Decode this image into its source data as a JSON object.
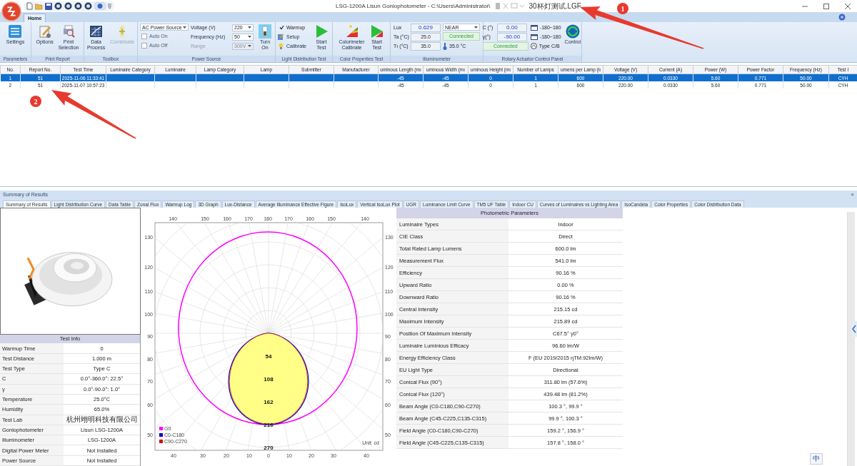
{
  "window": {
    "title": "LSG-1200A Lisun Goniophotometer  - C:\\Users\\Administrator\\",
    "title_tail": "30杯灯测试.LGF"
  },
  "ribbon_tabs": [
    {
      "label": "Home",
      "selected": true
    }
  ],
  "ribbon": {
    "groups": [
      {
        "caption": "Parameters",
        "buttons": [
          {
            "label": "Settings",
            "disabled": false
          }
        ]
      },
      {
        "caption": "Print Report",
        "buttons": [
          {
            "label": "Options",
            "disabled": false
          },
          {
            "label": "Print Selection",
            "disabled": false
          }
        ]
      },
      {
        "caption": "Toolbox",
        "buttons": [
          {
            "label": "Data Process",
            "disabled": false
          },
          {
            "label": "Combinate",
            "disabled": true
          }
        ]
      },
      {
        "caption": "Power Source",
        "source": "AC Power Source",
        "checks": [
          {
            "label": "Auto On",
            "checked": false
          },
          {
            "label": "Auto Off",
            "checked": false
          }
        ],
        "fields": [
          {
            "label": "Voltage (V)",
            "value": "220",
            "disabled": false
          },
          {
            "label": "Frequency (Hz)",
            "value": "50",
            "disabled": false
          },
          {
            "label": "Range",
            "value": "300V",
            "disabled": true
          }
        ],
        "buttons": [
          {
            "label": "Turn On",
            "disabled": false
          }
        ]
      },
      {
        "caption": "Light Distribution Test",
        "checks": [
          {
            "label": "Warmup",
            "checked": true
          }
        ],
        "links": [
          "Setup",
          "Calibrate"
        ],
        "buttons": [
          {
            "label": "Start Test",
            "disabled": false
          }
        ]
      },
      {
        "caption": "Color Properties Test",
        "buttons": [
          {
            "label": "Colorimeter Calibrate",
            "disabled": false
          },
          {
            "label": "Start Test",
            "disabled": false
          }
        ]
      },
      {
        "caption": "Illuminometer",
        "readings": [
          {
            "label": "Lux",
            "value": "0.629"
          },
          {
            "label": "Ta (°C)",
            "value": "25.0"
          },
          {
            "label": "Tı (°C)",
            "value": "35.0"
          }
        ],
        "mode": "NEAR",
        "status": "Connected",
        "temperature": "35.0 °C"
      },
      {
        "caption": "Rotary Actuator Control Panel",
        "readings": [
          {
            "label": "C (°)",
            "value": "0.00"
          },
          {
            "label": "γ(°)",
            "value": "-90.00"
          }
        ],
        "status": "Connected",
        "ranges": [
          "-180~180",
          "-180~180"
        ],
        "type": "Type C/B",
        "buttons": [
          {
            "label": "Control",
            "disabled": false
          }
        ]
      }
    ]
  },
  "table": {
    "columns": [
      "No.",
      "Report No.",
      "Test Time",
      "Luminaire Category",
      "Luminaire",
      "Lamp Category",
      "Lamp",
      "Submitter",
      "Manufacturer",
      "uminous Length (mı",
      "uminous Width (mı",
      "uminous Height (mı",
      "Number of Lamps",
      "umens per Lamp (lı",
      "Voltage (V)",
      "Current (A)",
      "Power (W)",
      "Power Factor",
      "Frequency (Hz)",
      "Test I"
    ],
    "rows": [
      {
        "selected": true,
        "cells": [
          "1",
          "51",
          "2025-11-06 11:33:41",
          null,
          null,
          null,
          null,
          null,
          null,
          "-45",
          "-45",
          "0",
          "1",
          "600",
          "220.00",
          "0.0330",
          "5.60",
          "0.771",
          "50.00",
          "CYH"
        ]
      },
      {
        "selected": false,
        "cells": [
          "2",
          "51",
          "2025-11-07 10:57:23",
          null,
          null,
          null,
          null,
          null,
          null,
          "-45",
          "-45",
          "0",
          "1",
          "600",
          "220.00",
          "0.0330",
          "5.60",
          "0.771",
          "50.00",
          "CYH"
        ]
      }
    ]
  },
  "results": {
    "title": "Summary of Results",
    "close": "×",
    "tabs": [
      {
        "label": "Summary of Results",
        "selected": true
      },
      {
        "label": "Light Distribution Curve",
        "selected": false
      },
      {
        "label": "Data Table",
        "selected": false
      },
      {
        "label": "Zonal Flux",
        "selected": false
      },
      {
        "label": "Warmup Log",
        "selected": false
      },
      {
        "label": "3D Graph",
        "selected": false
      },
      {
        "label": "Lux-Distance",
        "selected": false
      },
      {
        "label": "Average Illuminance Effective Figure",
        "selected": false
      },
      {
        "label": "IsoLux",
        "selected": false
      },
      {
        "label": "Vertical IsoLux Plot",
        "selected": false
      },
      {
        "label": "UGR",
        "selected": false
      },
      {
        "label": "Luminance Limit Curve",
        "selected": false
      },
      {
        "label": "TM5 UF Table",
        "selected": false
      },
      {
        "label": "Indoor CU",
        "selected": false
      },
      {
        "label": "Curves of Luminaires vs Lighting Area",
        "selected": false
      },
      {
        "label": "IsoCandela",
        "selected": false
      },
      {
        "label": "Color Properties",
        "selected": false
      },
      {
        "label": "Color Distribution Data",
        "selected": false
      }
    ],
    "test_info": {
      "title": "Test Info",
      "rows": [
        {
          "label": "Warmup Time",
          "value": "0"
        },
        {
          "label": "Test Distance",
          "value": "1.000 m"
        },
        {
          "label": "Test Type",
          "value": "Type C"
        },
        {
          "label": "C",
          "value": "0.0°-360.0°: 22.5°"
        },
        {
          "label": "γ",
          "value": "0.0°-90.0°: 1.0°"
        },
        {
          "label": "Temperature",
          "value": "25.0°C"
        },
        {
          "label": "Humidity",
          "value": "65.0%"
        },
        {
          "label": "Test Lab",
          "value": "杭州翊明科技有限公司"
        },
        {
          "label": "Goniophotometer",
          "value": "Lisun LSG-1200A"
        },
        {
          "label": "Illuminometer",
          "value": "LSG-1200A"
        },
        {
          "label": "Digital Power Meter",
          "value": "Not Installed"
        },
        {
          "label": "Power Source",
          "value": "Not Installed"
        }
      ]
    },
    "chart": {
      "top_ticks": [
        "140",
        "150",
        "160",
        "170",
        "180",
        "170",
        "160",
        "150",
        "140"
      ],
      "bottom_ticks": [
        "40",
        "30",
        "20",
        "10",
        "0",
        "10",
        "20",
        "30",
        "40"
      ],
      "left_ticks": [
        "130",
        "120",
        "110",
        "100",
        "90",
        "80",
        "70",
        "60",
        "50"
      ],
      "right_ticks": [
        "130",
        "120",
        "110",
        "100",
        "90",
        "80",
        "70",
        "60",
        "50"
      ],
      "radial_labels": [
        "54",
        "108",
        "162",
        "216",
        "270"
      ],
      "legend": [
        {
          "label": "G0",
          "color": "#ff00ff"
        },
        {
          "label": "C0-C180",
          "color": "#0000cc"
        },
        {
          "label": "C90-C270",
          "color": "#dd0000"
        }
      ],
      "unit": "Unit: cd"
    },
    "parameters": {
      "title": "Photometric Parameters",
      "rows": [
        {
          "label": "Luminaire Types",
          "value": "Indoor"
        },
        {
          "label": "CIE Class",
          "value": "Direct"
        },
        {
          "label": "Total Rated Lamp Lumens",
          "value": "600.0 lm"
        },
        {
          "label": "Measurement Flux",
          "value": "541.0 lm"
        },
        {
          "label": "Efficiency",
          "value": "90.16 %"
        },
        {
          "label": "Upward Ratio",
          "value": "0.00 %"
        },
        {
          "label": "Downward Ratio",
          "value": "90.16 %"
        },
        {
          "label": "Central Intensity",
          "value": "215.15 cd"
        },
        {
          "label": "Maximum Intensity",
          "value": "215.89 cd"
        },
        {
          "label": "Position Of Maximum Intensity",
          "value": "C67.5° γ0°"
        },
        {
          "label": "Luminaire Luminious Efficacy",
          "value": "96.60 lm/W"
        },
        {
          "label": "Energy Efficiency Class",
          "value": "F (EU 2019/2015 ηTM:92lm/W)"
        },
        {
          "label": "EU Light Type",
          "value": "Directional"
        },
        {
          "label": "Conical Flux (90°)",
          "value": "311.80 lm (57.6%)"
        },
        {
          "label": "Conical Flux (120°)",
          "value": "439.48 lm (81.2%)"
        },
        {
          "label": "Beam Angle (C0-C180,C90-C270)",
          "value": "100.3 °, 99.9 °"
        },
        {
          "label": "Beam Angle (C45-C225,C135-C315)",
          "value": "99.9 °, 100.3 °"
        },
        {
          "label": "Field Angle (C0-C180,C90-C270)",
          "value": "159.2 °, 156.9 °"
        },
        {
          "label": "Field Angle (C45-C225,C135-C315)",
          "value": "157.8 °, 158.0 °"
        }
      ]
    }
  },
  "annotations": [
    {
      "label": "1"
    },
    {
      "label": "2"
    }
  ],
  "ime": {
    "label": "中"
  }
}
